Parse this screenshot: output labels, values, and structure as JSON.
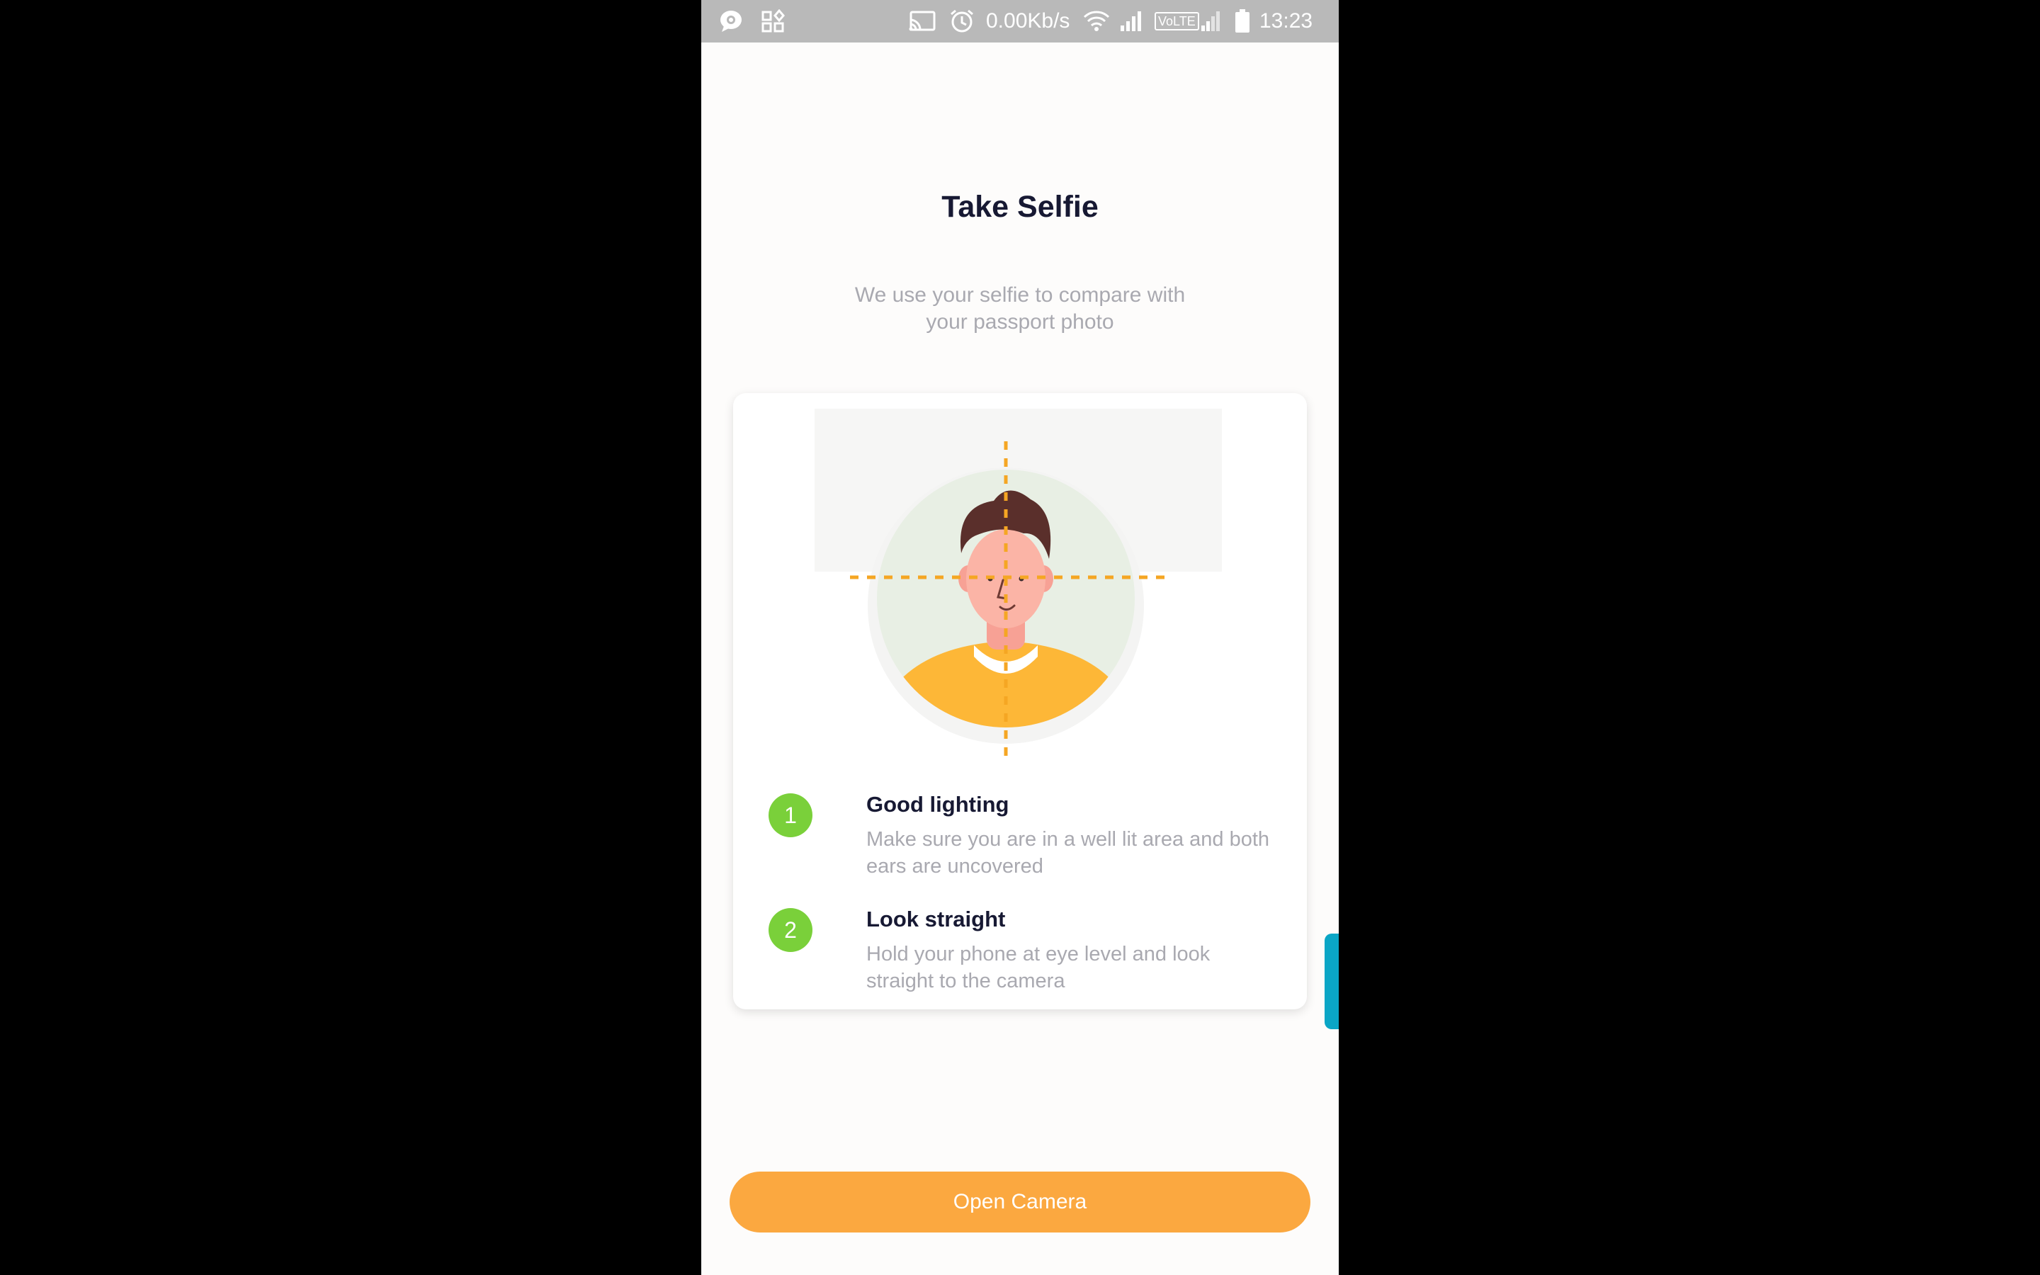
{
  "status_bar": {
    "network_speed": "0.00Kb/s",
    "volte_label": "VoLTE",
    "time": "13:23",
    "icons": [
      "chat-bubble-icon",
      "apps-icon",
      "cast-icon",
      "alarm-icon",
      "wifi-icon",
      "signal-icon",
      "volte-icon",
      "signal-icon",
      "battery-icon"
    ]
  },
  "page": {
    "title": "Take Selfie",
    "subtitle_line1": "We use your selfie to compare with",
    "subtitle_line2": "your passport photo"
  },
  "tips": [
    {
      "number": "1",
      "title": "Good lighting",
      "desc_line1": "Make sure you are in a well lit area and both",
      "desc_line2": "ears are uncovered"
    },
    {
      "number": "2",
      "title": "Look straight",
      "desc_line1": "Hold your phone at eye level and look",
      "desc_line2": "straight to the camera"
    }
  ],
  "actions": {
    "open_camera_label": "Open Camera"
  },
  "colors": {
    "accent": "#fba840",
    "step_badge": "#7ad03a",
    "title_text": "#171933",
    "muted_text": "#a9a9b0",
    "side_tab": "#0aa6c6"
  }
}
